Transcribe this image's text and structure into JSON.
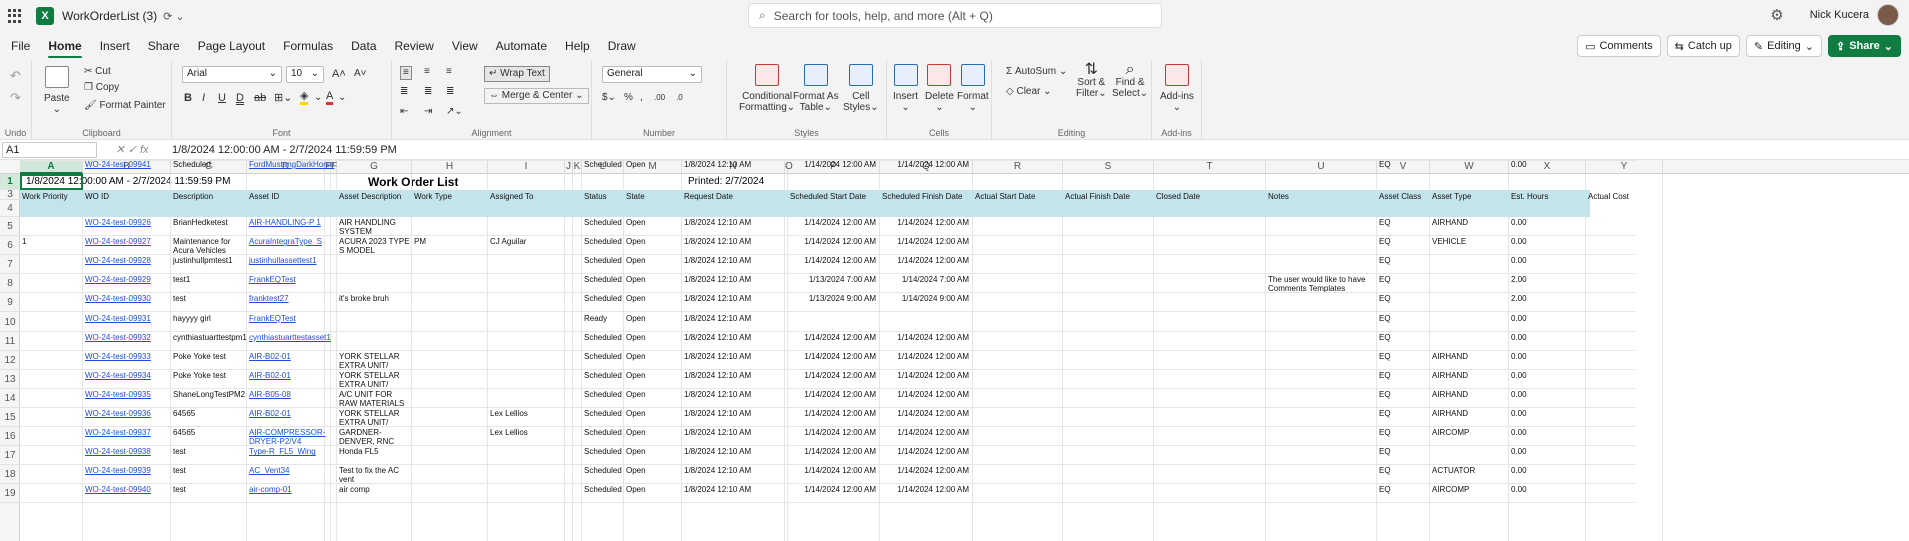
{
  "app": {
    "title": "WorkOrderList (3)",
    "status_icon": "sync-icon",
    "search_placeholder": "Search for tools, help, and more (Alt + Q)",
    "user_name": "Nick Kucera"
  },
  "menu": {
    "tabs": [
      "File",
      "Home",
      "Insert",
      "Share",
      "Page Layout",
      "Formulas",
      "Data",
      "Review",
      "View",
      "Automate",
      "Help",
      "Draw"
    ],
    "active": "Home",
    "comments": "Comments",
    "catch_up": "Catch up",
    "editing": "Editing",
    "share": "Share"
  },
  "ribbon": {
    "undo_group": "Undo",
    "clipboard": {
      "label": "Clipboard",
      "paste": "Paste",
      "cut": "Cut",
      "copy": "Copy",
      "format_painter": "Format Painter"
    },
    "font": {
      "label": "Font",
      "name": "Arial",
      "size": "10"
    },
    "alignment": {
      "label": "Alignment",
      "wrap_text": "Wrap Text",
      "merge_center": "Merge & Center"
    },
    "number": {
      "label": "Number",
      "format": "General"
    },
    "styles": {
      "label": "Styles",
      "conditional": "Conditional",
      "conditional2": "Formatting",
      "format_as": "Format As",
      "format_as2": "Table",
      "cell": "Cell",
      "cell2": "Styles"
    },
    "cells": {
      "label": "Cells",
      "insert": "Insert",
      "delete": "Delete",
      "format": "Format"
    },
    "editing": {
      "label": "Editing",
      "autosum": "AutoSum",
      "clear": "Clear",
      "sort": "Sort &",
      "sort2": "Filter",
      "find": "Find &",
      "find2": "Select"
    },
    "addins": {
      "label": "Add-ins",
      "addins": "Add-ins"
    }
  },
  "formula_bar": {
    "name_box": "A1",
    "fx": "fx",
    "content": "1/8/2024 12:00:00 AM - 2/7/2024 11:59:59 PM"
  },
  "sheet": {
    "columns": [
      "A",
      "B",
      "C",
      "D",
      "E",
      "F",
      "G",
      "H",
      "I",
      "J",
      "K",
      "L",
      "M",
      "N",
      "O",
      "P",
      "Q",
      "R",
      "S",
      "T",
      "U",
      "V",
      "W",
      "X",
      "Y"
    ],
    "row_numbers": [
      "1",
      "3",
      "4",
      "5",
      "6",
      "7",
      "8",
      "9",
      "10",
      "11",
      "12",
      "13",
      "14",
      "15",
      "16",
      "17",
      "18",
      "19"
    ],
    "title_range": "1/8/2024 12:00:00 AM - 2/7/2024 11:59:59 PM",
    "title": "Work Order List",
    "printed": "Printed: 2/7/2024",
    "headers": [
      "Work Priority",
      "WO ID",
      "Description",
      "Asset ID",
      "Asset Description",
      "Work Type",
      "Assigned To",
      "Status",
      "State",
      "Request Date",
      "Scheduled Start Date",
      "Scheduled Finish Date",
      "Actual Start Date",
      "Actual Finish Date",
      "Closed Date",
      "Notes",
      "Asset Class",
      "Asset Type",
      "Est. Hours",
      "Actual Cost"
    ],
    "rows": [
      [
        "",
        "WO-24-test-09926",
        "BrianHedketest",
        "AIR-HANDLING-P 1",
        "AIR HANDLING SYSTEM",
        "",
        "",
        "Scheduled",
        "Open",
        "1/8/2024 12:10 AM",
        "1/14/2024 12:00 AM",
        "1/14/2024 12:00 AM",
        "",
        "",
        "",
        "",
        "EQ",
        "AIRHAND",
        "0.00",
        ""
      ],
      [
        "1",
        "WO-24-test-09927",
        "Maintenance for Acura Vehicles",
        "AcuraIntegraType_S",
        "ACURA 2023 TYPE S MODEL",
        "PM",
        "CJ Aguilar",
        "Scheduled",
        "Open",
        "1/8/2024 12:10 AM",
        "1/14/2024 12:00 AM",
        "1/14/2024 12:00 AM",
        "",
        "",
        "",
        "",
        "EQ",
        "VEHICLE",
        "0.00",
        ""
      ],
      [
        "",
        "WO-24-test-09928",
        "justinhullpmtest1",
        "justinhullassettest1",
        "",
        "",
        "",
        "Scheduled",
        "Open",
        "1/8/2024 12:10 AM",
        "1/14/2024 12:00 AM",
        "1/14/2024 12:00 AM",
        "",
        "",
        "",
        "",
        "EQ",
        "",
        "0.00",
        ""
      ],
      [
        "",
        "WO-24-test-09929",
        "test1",
        "FrankEQTest",
        "",
        "",
        "",
        "Scheduled",
        "Open",
        "1/8/2024 12:10 AM",
        "1/13/2024 7:00 AM",
        "1/14/2024 7:00 AM",
        "",
        "",
        "",
        "The user would like to have Comments Templates",
        "EQ",
        "",
        "2.00",
        ""
      ],
      [
        "",
        "WO-24-test-09930",
        "test",
        "franktest27",
        "it's broke bruh",
        "",
        "",
        "Scheduled",
        "Open",
        "1/8/2024 12:10 AM",
        "1/13/2024 9:00 AM",
        "1/14/2024 9:00 AM",
        "",
        "",
        "",
        "",
        "EQ",
        "",
        "2.00",
        ""
      ],
      [
        "",
        "WO-24-test-09931",
        "hayyyy girl",
        "FrankEQTest",
        "",
        "",
        "",
        "Ready",
        "Open",
        "1/8/2024 12:10 AM",
        "",
        "",
        "",
        "",
        "",
        "",
        "EQ",
        "",
        "0.00",
        ""
      ],
      [
        "",
        "WO-24-test-09932",
        "cynthiastuarttestpm1",
        "cynthiastuarttestasset1",
        "",
        "",
        "",
        "Scheduled",
        "Open",
        "1/8/2024 12:10 AM",
        "1/14/2024 12:00 AM",
        "1/14/2024 12:00 AM",
        "",
        "",
        "",
        "",
        "EQ",
        "",
        "0.00",
        ""
      ],
      [
        "",
        "WO-24-test-09933",
        "Poke Yoke test",
        "AIR-B02-01",
        "YORK STELLAR EXTRA UNIT/",
        "",
        "",
        "Scheduled",
        "Open",
        "1/8/2024 12:10 AM",
        "1/14/2024 12:00 AM",
        "1/14/2024 12:00 AM",
        "",
        "",
        "",
        "",
        "EQ",
        "AIRHAND",
        "0.00",
        ""
      ],
      [
        "",
        "WO-24-test-09934",
        "Poke Yoke test",
        "AIR-B02-01",
        "YORK STELLAR EXTRA UNIT/",
        "",
        "",
        "Scheduled",
        "Open",
        "1/8/2024 12:10 AM",
        "1/14/2024 12:00 AM",
        "1/14/2024 12:00 AM",
        "",
        "",
        "",
        "",
        "EQ",
        "AIRHAND",
        "0.00",
        ""
      ],
      [
        "",
        "WO-24-test-09935",
        "ShaneLongTestPM2",
        "AIR-B05-08",
        "A/C UNIT FOR RAW MATERIALS",
        "",
        "",
        "Scheduled",
        "Open",
        "1/8/2024 12:10 AM",
        "1/14/2024 12:00 AM",
        "1/14/2024 12:00 AM",
        "",
        "",
        "",
        "",
        "EQ",
        "AIRHAND",
        "0.00",
        ""
      ],
      [
        "",
        "WO-24-test-09936",
        "64565",
        "AIR-B02-01",
        "YORK STELLAR EXTRA UNIT/",
        "",
        "Lex Lellios",
        "Scheduled",
        "Open",
        "1/8/2024 12:10 AM",
        "1/14/2024 12:00 AM",
        "1/14/2024 12:00 AM",
        "",
        "",
        "",
        "",
        "EQ",
        "AIRHAND",
        "0.00",
        ""
      ],
      [
        "",
        "WO-24-test-09937",
        "64565",
        "AIR-COMPRESSOR-DRYER-P2/V4",
        "GARDNER-DENVER, RNC SERIES",
        "",
        "Lex Lellios",
        "Scheduled",
        "Open",
        "1/8/2024 12:10 AM",
        "1/14/2024 12:00 AM",
        "1/14/2024 12:00 AM",
        "",
        "",
        "",
        "",
        "EQ",
        "AIRCOMP",
        "0.00",
        ""
      ],
      [
        "",
        "WO-24-test-09938",
        "test",
        "Type-R_FL5_Wing",
        "Honda FL5",
        "",
        "",
        "Scheduled",
        "Open",
        "1/8/2024 12:10 AM",
        "1/14/2024 12:00 AM",
        "1/14/2024 12:00 AM",
        "",
        "",
        "",
        "",
        "EQ",
        "",
        "0.00",
        ""
      ],
      [
        "",
        "WO-24-test-09939",
        "test",
        "AC_Vent34",
        "Test to fix the AC vent",
        "",
        "",
        "Scheduled",
        "Open",
        "1/8/2024 12:10 AM",
        "1/14/2024 12:00 AM",
        "1/14/2024 12:00 AM",
        "",
        "",
        "",
        "",
        "EQ",
        "ACTUATOR",
        "0.00",
        ""
      ],
      [
        "",
        "WO-24-test-09940",
        "test",
        "air-comp-01",
        "air comp",
        "",
        "",
        "Scheduled",
        "Open",
        "1/8/2024 12:10 AM",
        "1/14/2024 12:00 AM",
        "1/14/2024 12:00 AM",
        "",
        "",
        "",
        "",
        "EQ",
        "AIRCOMP",
        "0.00",
        ""
      ],
      [
        "",
        "WO-24-test-09941",
        "Scheduled.",
        "FordMustangDarkHorse",
        "",
        "",
        "",
        "Scheduled",
        "Open",
        "1/8/2024 12:10 AM",
        "1/14/2024 12:00 AM",
        "1/14/2024 12:00 AM",
        "",
        "",
        "",
        "",
        "EQ",
        "",
        "0.00",
        ""
      ]
    ]
  }
}
